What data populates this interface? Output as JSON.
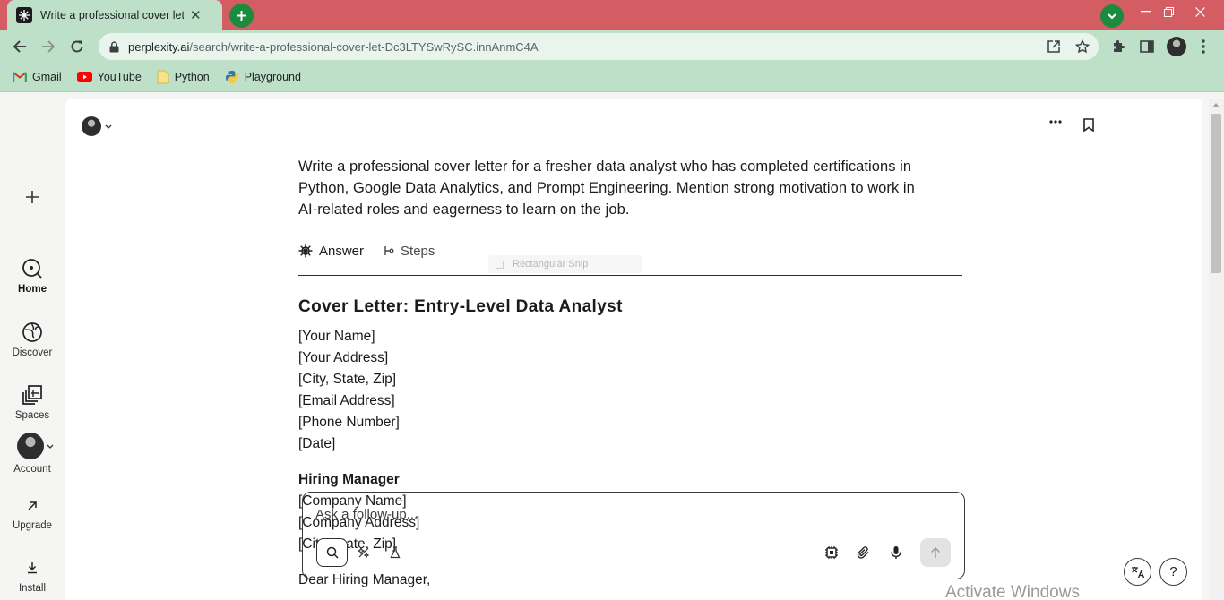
{
  "browser": {
    "tab_title": "Write a professional cover letter f",
    "tab_close": "✕",
    "url_host": "perplexity.ai",
    "url_path": "/search/write-a-professional-cover-let-Dc3LTYSwRySC.innAnmC4A",
    "bookmarks": [
      {
        "label": "Gmail",
        "icon": "gmail-icon"
      },
      {
        "label": "YouTube",
        "icon": "youtube-icon"
      },
      {
        "label": "Python",
        "icon": "folder-icon"
      },
      {
        "label": "Playground",
        "icon": "python-icon"
      }
    ],
    "accent_color": "#d35d63",
    "toolbar_color": "#bfe0c8"
  },
  "sidebar": {
    "new_thread_icon": "plus-icon",
    "items": [
      {
        "label": "Home",
        "icon": "home-search-icon",
        "active": true
      },
      {
        "label": "Discover",
        "icon": "globe-icon"
      },
      {
        "label": "Spaces",
        "icon": "spaces-icon"
      },
      {
        "label": "Account",
        "icon": "avatar"
      },
      {
        "label": "Upgrade",
        "icon": "arrow-up-right-icon"
      },
      {
        "label": "Install",
        "icon": "download-icon"
      }
    ]
  },
  "thread": {
    "query": "Write a professional cover letter for a fresher data analyst who has completed certifications in Python, Google Data Analytics, and Prompt Engineering. Mention strong motivation to work in AI-related roles and eagerness to learn on the job.",
    "tabs": [
      {
        "label": "Answer",
        "icon": "perplexity-icon",
        "active": true
      },
      {
        "label": "Steps",
        "icon": "steps-icon"
      }
    ],
    "ghost_chip": "Rectangular Snip"
  },
  "answer": {
    "heading": "Cover Letter: Entry-Level Data Analyst",
    "sender_lines": [
      "[Your Name]",
      "[Your Address]",
      "[City, State, Zip]",
      "[Email Address]",
      "[Phone Number]",
      "[Date]"
    ],
    "recipient_title": "Hiring Manager",
    "recipient_lines": [
      "[Company Name]",
      "[Company Address]",
      "[City, State, Zip]"
    ],
    "salutation": "Dear Hiring Manager,"
  },
  "composer": {
    "placeholder": "Ask a follow-up...",
    "modes": [
      "search-mode-icon",
      "research-mode-icon",
      "labs-mode-icon"
    ],
    "actions": [
      "model-chip-icon",
      "attach-icon",
      "mic-icon",
      "send-arrow-icon"
    ]
  },
  "floating": {
    "language_icon": "translate-icon",
    "help_label": "?"
  },
  "watermark": "Activate Windows"
}
